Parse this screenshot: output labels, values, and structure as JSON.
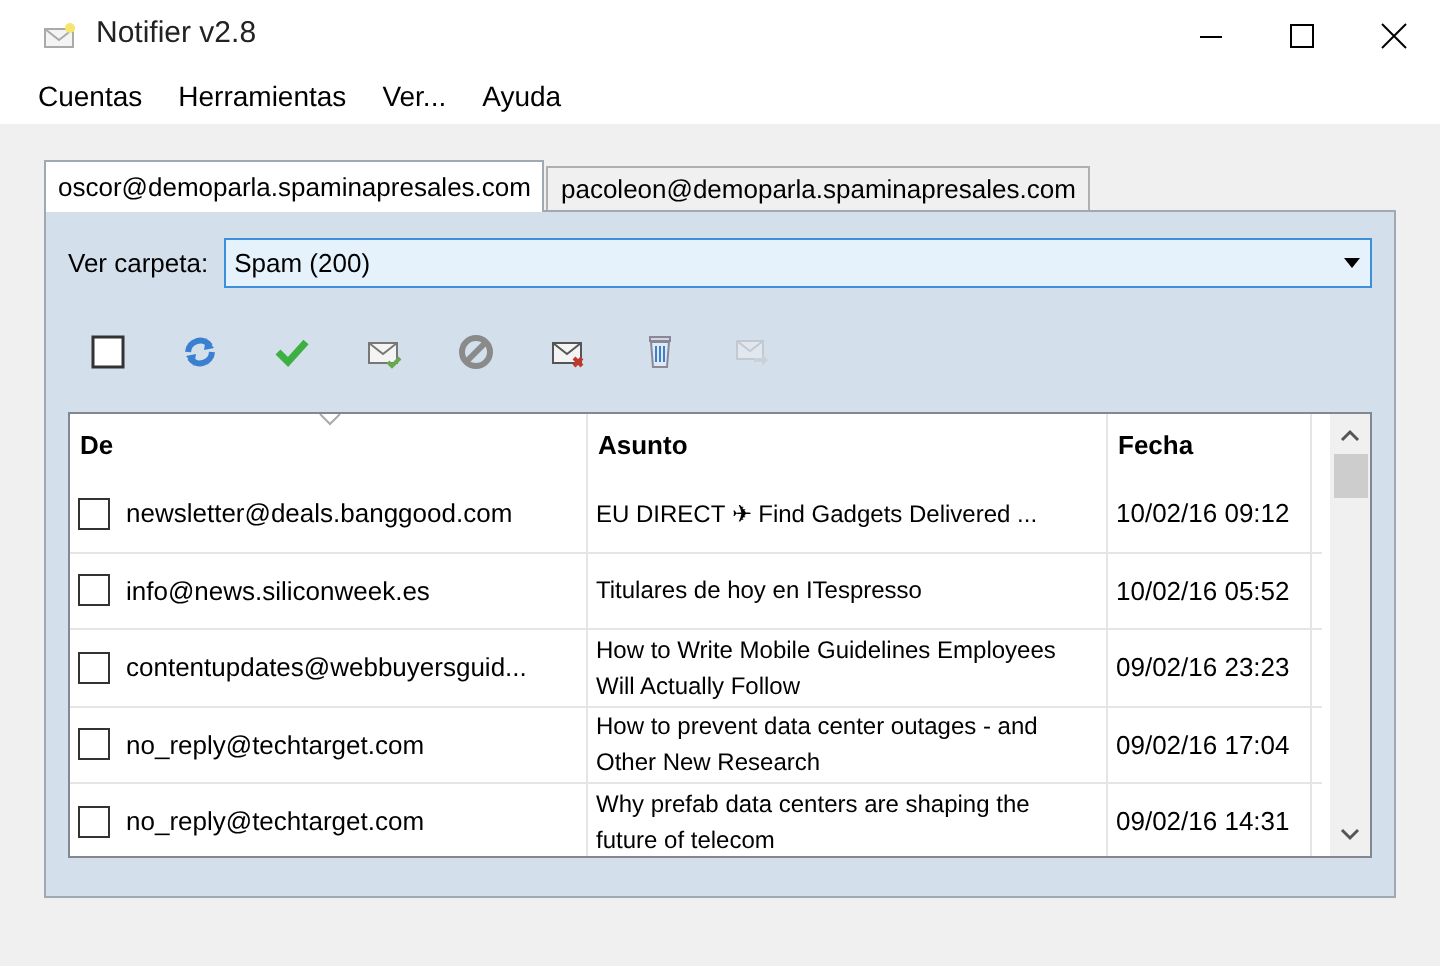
{
  "window": {
    "title": "Notifier v2.8"
  },
  "menu": [
    "Cuentas",
    "Herramientas",
    "Ver...",
    "Ayuda"
  ],
  "tabs": [
    {
      "label": "oscor@demoparla.spaminapresales.com",
      "selected": true
    },
    {
      "label": "pacoleon@demoparla.spaminapresales.com",
      "selected": false
    }
  ],
  "folder": {
    "label": "Ver carpeta:",
    "value": "Spam (200)"
  },
  "select_all": {
    "checked": false
  },
  "toolbar": [
    {
      "kind": "refresh",
      "disabled": false
    },
    {
      "kind": "check",
      "disabled": false
    },
    {
      "kind": "mail-read",
      "disabled": false
    },
    {
      "kind": "block",
      "disabled": false
    },
    {
      "kind": "mail-delete",
      "disabled": false
    },
    {
      "kind": "trash",
      "disabled": false
    },
    {
      "kind": "mail-forward",
      "disabled": true
    }
  ],
  "table": {
    "columns": [
      "De",
      "Asunto",
      "Fecha"
    ],
    "rows": [
      {
        "checked": false,
        "from": "newsletter@deals.banggood.com",
        "subject": "EU DIRECT ✈ Find Gadgets Delivered ...",
        "date": "10/02/16 09:12"
      },
      {
        "checked": false,
        "from": "info@news.siliconweek.es",
        "subject": "Titulares de hoy en ITespresso",
        "date": "10/02/16 05:52"
      },
      {
        "checked": false,
        "from": "contentupdates@webbuyersguid...",
        "subject": "How to Write Mobile Guidelines Employees Will Actually Follow",
        "date": "09/02/16 23:23"
      },
      {
        "checked": false,
        "from": "no_reply@techtarget.com",
        "subject": "How to prevent data center outages - and Other New Research",
        "date": "09/02/16 17:04"
      },
      {
        "checked": false,
        "from": "no_reply@techtarget.com",
        "subject": "Why prefab data centers are shaping the future of telecom",
        "date": "09/02/16 14:31"
      }
    ]
  }
}
